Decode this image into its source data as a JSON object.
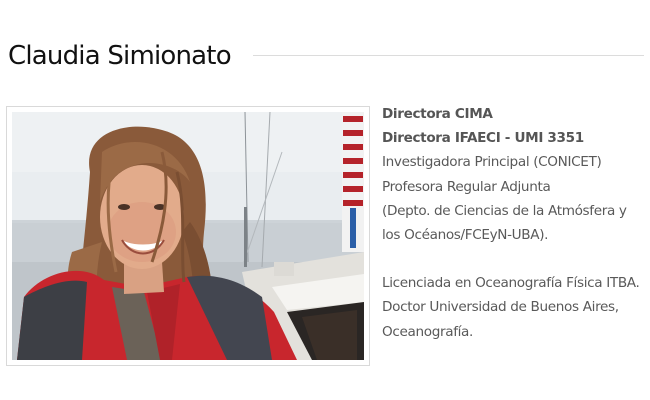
{
  "profile": {
    "name": "Claudia Simionato",
    "photo_icon": "portrait-photo"
  },
  "bio": {
    "roles": [
      "Directora CIMA",
      "Directora IFAECI - UMI 3351"
    ],
    "positions": [
      "Investigadora Principal (CONICET)",
      "Profesora Regular Adjunta",
      "(Depto. de Ciencias de la Atmósfera y",
      "los Océanos/FCEyN-UBA)."
    ],
    "education": [
      "Licenciada en Oceanografía Física ITBA.",
      "Doctor Universidad de Buenos Aires,",
      "Oceanografía."
    ]
  },
  "colors": {
    "title": "#111111",
    "text": "#595959",
    "rule": "#dcdcdc",
    "jacket": "#c8262d"
  }
}
